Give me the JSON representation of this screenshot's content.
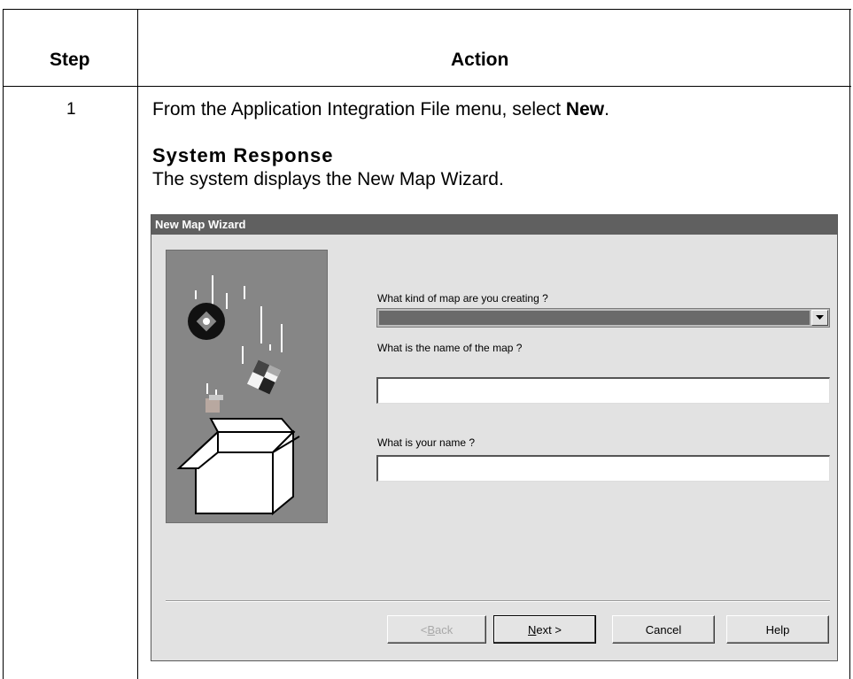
{
  "table": {
    "header_step": "Step",
    "header_action": "Action",
    "step_number": "1",
    "instruction_prefix": "From the Application Integration File menu, select ",
    "instruction_bold": "New",
    "instruction_suffix": ".",
    "response_title": "System Response",
    "response_text": "The system displays the New Map Wizard."
  },
  "wizard": {
    "title": "New Map Wizard",
    "q_kind": "What kind of map are you creating ?",
    "kind_value": "",
    "q_map_name": "What is the name of the map ?",
    "map_name_value": "",
    "q_your_name": "What is your name ?",
    "your_name_value": "",
    "buttons": {
      "back_prefix": "< ",
      "back_mnemonic": "B",
      "back_rest": "ack",
      "next_mnemonic": "N",
      "next_rest": "ext >",
      "cancel": "Cancel",
      "help": "Help"
    }
  },
  "colors": {
    "titlebar": "#606060",
    "window_bg": "#e2e2e2",
    "art_bg": "#868686"
  },
  "icons": {
    "dropdown": "chevron-down-icon",
    "illustration": "wizard-box-illustration"
  }
}
